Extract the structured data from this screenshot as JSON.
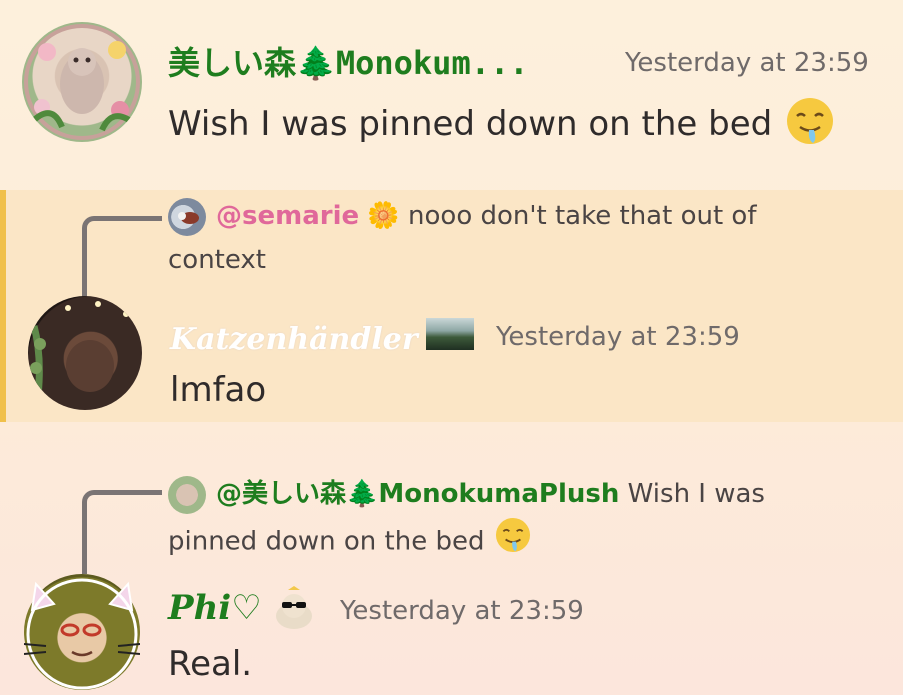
{
  "messages": [
    {
      "username": "美しい森🌲Monokum...",
      "timestamp": "Yesterday at 23:59",
      "text": "Wish I was pinned down on the bed",
      "emoji": "drooling-face"
    },
    {
      "reply": {
        "mention": "@semarie",
        "mention_badge": "🌼",
        "text_line1": "nooo don't take that out of",
        "text_line2": "context"
      },
      "username": "Katzenhändler",
      "timestamp": "Yesterday at 23:59",
      "text": "lmfao"
    },
    {
      "reply": {
        "mention": "@美しい森🌲MonokumaPlush",
        "text_line1": "Wish I was",
        "text_line2": "pinned down on the bed",
        "emoji": "drooling-face"
      },
      "username": "Phi♡",
      "timestamp": "Yesterday at 23:59",
      "text": "Real."
    }
  ],
  "colors": {
    "highlight_bar": "#f0c04a",
    "highlight_bg": "#fbe6c6",
    "green_name": "#1e7d1e",
    "pink_mention": "#e0689a"
  }
}
